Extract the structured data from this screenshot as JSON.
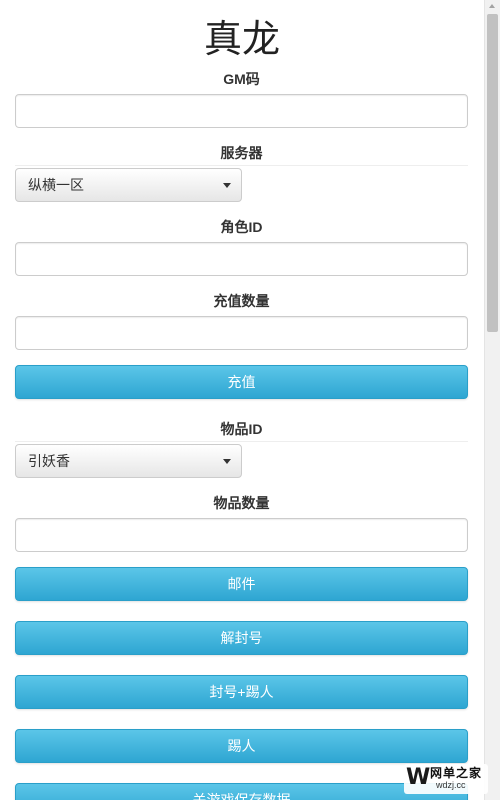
{
  "title": "真龙",
  "form": {
    "gm_code_label": "GM码",
    "gm_code_value": "",
    "server_label": "服务器",
    "server_selected": "纵横一区",
    "role_id_label": "角色ID",
    "role_id_value": "",
    "recharge_amount_label": "充值数量",
    "recharge_amount_value": "",
    "recharge_button": "充值",
    "item_id_label": "物品ID",
    "item_selected": "引妖香",
    "item_quantity_label": "物品数量",
    "item_quantity_value": "",
    "buttons": {
      "mail": "邮件",
      "unban": "解封号",
      "ban_kick": "封号+踢人",
      "kick": "踢人",
      "close_save": "关游戏保存数据"
    }
  },
  "watermark": {
    "logo": "W",
    "name": "网单之家",
    "url": "wdzj.cc"
  },
  "colors": {
    "button": "#39b3d7",
    "border": "#cccccc"
  }
}
